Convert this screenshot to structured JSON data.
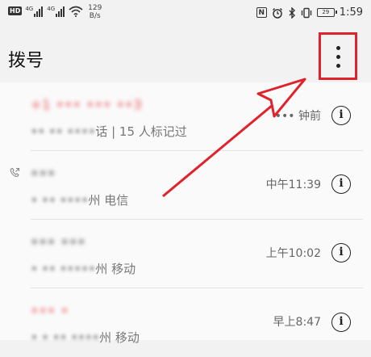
{
  "status_bar": {
    "hd_badge": "HD",
    "signal_1_gen": "4G",
    "signal_2_gen": "4G",
    "net_speed_value": "129",
    "net_speed_unit": "B/s",
    "nfc_label": "N",
    "battery_label": "29",
    "time": "1:59",
    "icons": [
      "nfc-icon",
      "alarm-icon",
      "bluetooth-icon",
      "vibrate-icon",
      "battery-icon"
    ]
  },
  "header": {
    "title": "拨号"
  },
  "calls": [
    {
      "name": "+1 ••• ••• ••3",
      "missed": true,
      "sub_masked": "•• •• ••••",
      "sub_visible": "话 | 15 人标记过",
      "time": "••• 钟前",
      "callback_icon": false
    },
    {
      "name": "•••",
      "missed": false,
      "sub_masked": "• •• ••••",
      "sub_visible": "州 电信",
      "time": "中午11:39",
      "callback_icon": true
    },
    {
      "name": "••• •••",
      "missed": false,
      "sub_masked": "• •• •••••",
      "sub_visible": "州 移动",
      "time": "上午10:02",
      "callback_icon": false
    },
    {
      "name": "••• •",
      "missed": true,
      "sub_masked": "• • •• ••••",
      "sub_visible": "州 移动",
      "time": "早上8:47",
      "callback_icon": false
    }
  ],
  "colors": {
    "annotation_red": "#e0222c",
    "missed_call": "#e8444a",
    "background": "#f2f2f2"
  }
}
